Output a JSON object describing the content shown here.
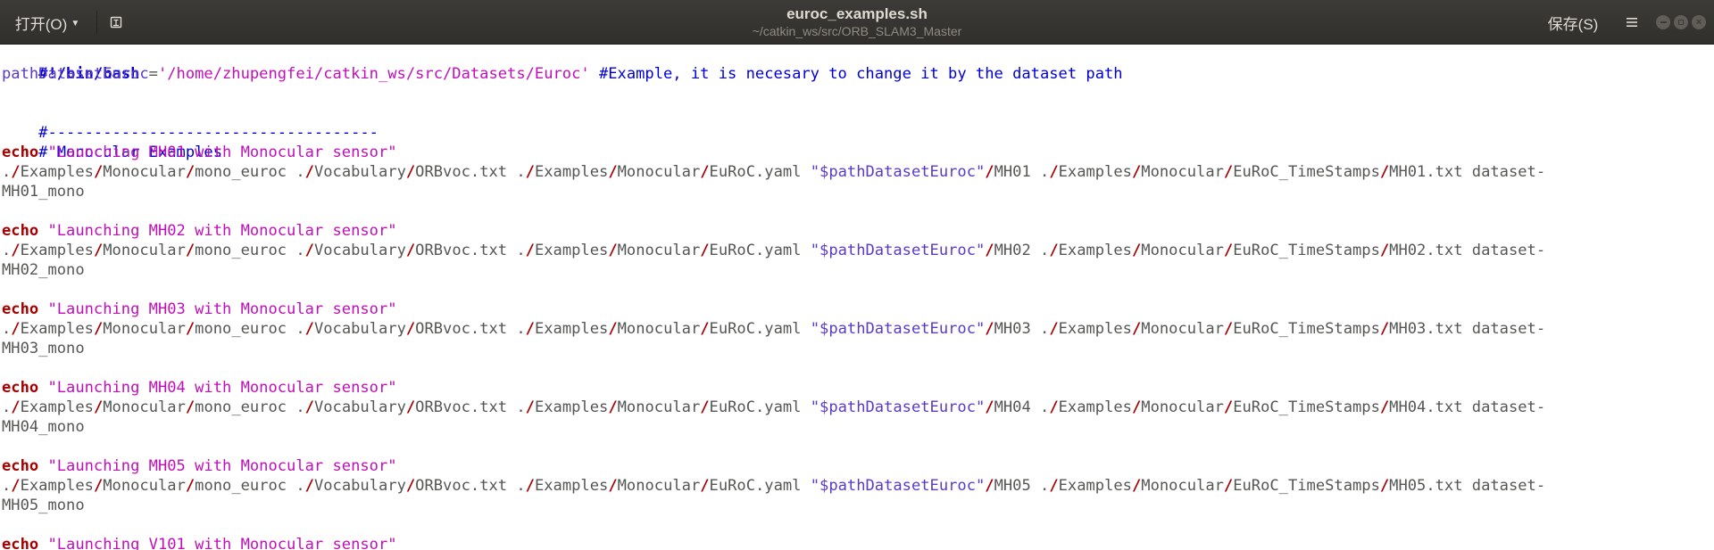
{
  "window": {
    "title": "euroc_examples.sh",
    "subtitle": "~/catkin_ws/src/ORB_SLAM3_Master",
    "open_label": "打开(O)",
    "save_label": "保存(S)"
  },
  "code": {
    "shebang": "#!/bin/bash",
    "assign_var": "pathDatasetEuroc",
    "assign_value": "'/home/zhupengfei/catkin_ws/src/Datasets/Euroc'",
    "assign_comment": "#Example, it is necesary to change it by the dataset path",
    "divider_comment": "#------------------------------------",
    "section_comment": "# Monocular Examples",
    "echo_keyword": "echo",
    "blocks": [
      {
        "echo_text": "\"Launching MH01 with Monocular sensor\"",
        "seq": "MH01",
        "timestamps": "MH01.txt",
        "output": "MH01_mono"
      },
      {
        "echo_text": "\"Launching MH02 with Monocular sensor\"",
        "seq": "MH02",
        "timestamps": "MH02.txt",
        "output": "MH02_mono"
      },
      {
        "echo_text": "\"Launching MH03 with Monocular sensor\"",
        "seq": "MH03",
        "timestamps": "MH03.txt",
        "output": "MH03_mono"
      },
      {
        "echo_text": "\"Launching MH04 with Monocular sensor\"",
        "seq": "MH04",
        "timestamps": "MH04.txt",
        "output": "MH04_mono"
      },
      {
        "echo_text": "\"Launching MH05 with Monocular sensor\"",
        "seq": "MH05",
        "timestamps": "MH05.txt",
        "output": "MH05_mono"
      }
    ],
    "last_echo_text": "\"Launching V101 with Monocular sensor\"",
    "cmd": {
      "dot": ".",
      "examples": "Examples",
      "monocular": "Monocular",
      "exe": "mono_euroc",
      "vocab_dir": "Vocabulary",
      "vocab_file": "ORBvoc.txt",
      "yaml": "EuRoC.yaml",
      "dataset_var": "\"$pathDatasetEuroc\"",
      "ts_dir": "EuRoC_TimeStamps",
      "dataset_prefix": "dataset-"
    }
  }
}
